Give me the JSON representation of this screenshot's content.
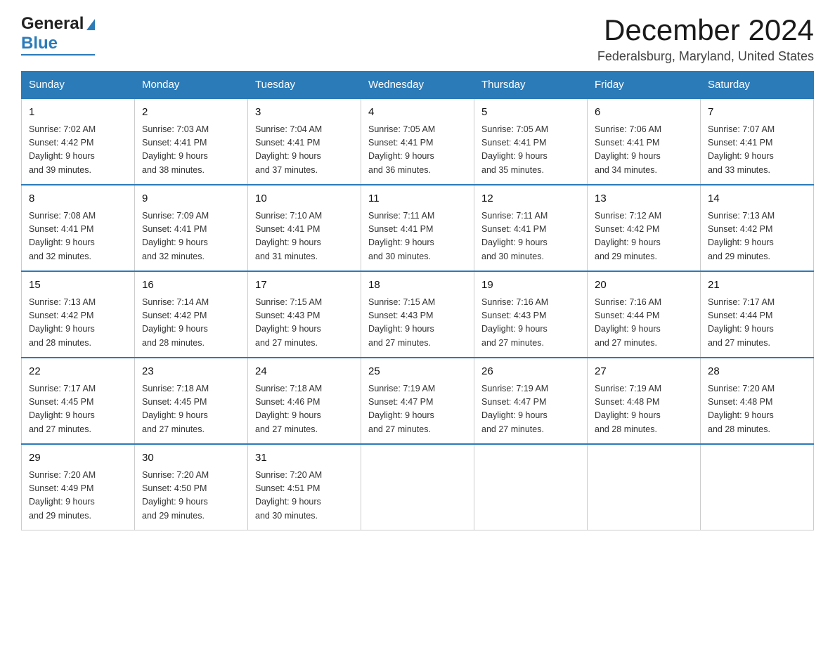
{
  "logo": {
    "general": "General",
    "blue": "Blue",
    "arrow": "▶"
  },
  "title": "December 2024",
  "subtitle": "Federalsburg, Maryland, United States",
  "days_of_week": [
    "Sunday",
    "Monday",
    "Tuesday",
    "Wednesday",
    "Thursday",
    "Friday",
    "Saturday"
  ],
  "weeks": [
    [
      {
        "day": "1",
        "sunrise": "7:02 AM",
        "sunset": "4:42 PM",
        "daylight": "9 hours and 39 minutes."
      },
      {
        "day": "2",
        "sunrise": "7:03 AM",
        "sunset": "4:41 PM",
        "daylight": "9 hours and 38 minutes."
      },
      {
        "day": "3",
        "sunrise": "7:04 AM",
        "sunset": "4:41 PM",
        "daylight": "9 hours and 37 minutes."
      },
      {
        "day": "4",
        "sunrise": "7:05 AM",
        "sunset": "4:41 PM",
        "daylight": "9 hours and 36 minutes."
      },
      {
        "day": "5",
        "sunrise": "7:05 AM",
        "sunset": "4:41 PM",
        "daylight": "9 hours and 35 minutes."
      },
      {
        "day": "6",
        "sunrise": "7:06 AM",
        "sunset": "4:41 PM",
        "daylight": "9 hours and 34 minutes."
      },
      {
        "day": "7",
        "sunrise": "7:07 AM",
        "sunset": "4:41 PM",
        "daylight": "9 hours and 33 minutes."
      }
    ],
    [
      {
        "day": "8",
        "sunrise": "7:08 AM",
        "sunset": "4:41 PM",
        "daylight": "9 hours and 32 minutes."
      },
      {
        "day": "9",
        "sunrise": "7:09 AM",
        "sunset": "4:41 PM",
        "daylight": "9 hours and 32 minutes."
      },
      {
        "day": "10",
        "sunrise": "7:10 AM",
        "sunset": "4:41 PM",
        "daylight": "9 hours and 31 minutes."
      },
      {
        "day": "11",
        "sunrise": "7:11 AM",
        "sunset": "4:41 PM",
        "daylight": "9 hours and 30 minutes."
      },
      {
        "day": "12",
        "sunrise": "7:11 AM",
        "sunset": "4:41 PM",
        "daylight": "9 hours and 30 minutes."
      },
      {
        "day": "13",
        "sunrise": "7:12 AM",
        "sunset": "4:42 PM",
        "daylight": "9 hours and 29 minutes."
      },
      {
        "day": "14",
        "sunrise": "7:13 AM",
        "sunset": "4:42 PM",
        "daylight": "9 hours and 29 minutes."
      }
    ],
    [
      {
        "day": "15",
        "sunrise": "7:13 AM",
        "sunset": "4:42 PM",
        "daylight": "9 hours and 28 minutes."
      },
      {
        "day": "16",
        "sunrise": "7:14 AM",
        "sunset": "4:42 PM",
        "daylight": "9 hours and 28 minutes."
      },
      {
        "day": "17",
        "sunrise": "7:15 AM",
        "sunset": "4:43 PM",
        "daylight": "9 hours and 27 minutes."
      },
      {
        "day": "18",
        "sunrise": "7:15 AM",
        "sunset": "4:43 PM",
        "daylight": "9 hours and 27 minutes."
      },
      {
        "day": "19",
        "sunrise": "7:16 AM",
        "sunset": "4:43 PM",
        "daylight": "9 hours and 27 minutes."
      },
      {
        "day": "20",
        "sunrise": "7:16 AM",
        "sunset": "4:44 PM",
        "daylight": "9 hours and 27 minutes."
      },
      {
        "day": "21",
        "sunrise": "7:17 AM",
        "sunset": "4:44 PM",
        "daylight": "9 hours and 27 minutes."
      }
    ],
    [
      {
        "day": "22",
        "sunrise": "7:17 AM",
        "sunset": "4:45 PM",
        "daylight": "9 hours and 27 minutes."
      },
      {
        "day": "23",
        "sunrise": "7:18 AM",
        "sunset": "4:45 PM",
        "daylight": "9 hours and 27 minutes."
      },
      {
        "day": "24",
        "sunrise": "7:18 AM",
        "sunset": "4:46 PM",
        "daylight": "9 hours and 27 minutes."
      },
      {
        "day": "25",
        "sunrise": "7:19 AM",
        "sunset": "4:47 PM",
        "daylight": "9 hours and 27 minutes."
      },
      {
        "day": "26",
        "sunrise": "7:19 AM",
        "sunset": "4:47 PM",
        "daylight": "9 hours and 27 minutes."
      },
      {
        "day": "27",
        "sunrise": "7:19 AM",
        "sunset": "4:48 PM",
        "daylight": "9 hours and 28 minutes."
      },
      {
        "day": "28",
        "sunrise": "7:20 AM",
        "sunset": "4:48 PM",
        "daylight": "9 hours and 28 minutes."
      }
    ],
    [
      {
        "day": "29",
        "sunrise": "7:20 AM",
        "sunset": "4:49 PM",
        "daylight": "9 hours and 29 minutes."
      },
      {
        "day": "30",
        "sunrise": "7:20 AM",
        "sunset": "4:50 PM",
        "daylight": "9 hours and 29 minutes."
      },
      {
        "day": "31",
        "sunrise": "7:20 AM",
        "sunset": "4:51 PM",
        "daylight": "9 hours and 30 minutes."
      },
      null,
      null,
      null,
      null
    ]
  ],
  "labels": {
    "sunrise": "Sunrise: ",
    "sunset": "Sunset: ",
    "daylight": "Daylight: "
  }
}
